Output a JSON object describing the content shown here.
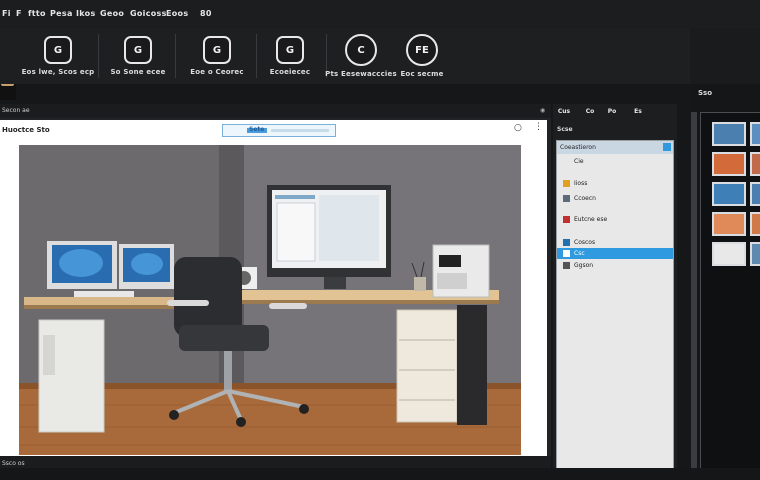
{
  "menubar": {
    "items": [
      "Fi",
      "F",
      "ftto",
      "Pesa",
      "Ikos",
      "Geoo",
      "Goicoss",
      "Eoos",
      "80"
    ]
  },
  "toolbar": {
    "tools": [
      {
        "icon_text": "G",
        "label": "Eos lwe, Scos ecp",
        "icon": "gear-icon"
      },
      {
        "icon_text": "G",
        "label": "So Sone ecee",
        "icon": "gear-icon"
      },
      {
        "icon_text": "G",
        "label": "Eoe o Ceorec",
        "icon": "gear-icon"
      },
      {
        "icon_text": "G",
        "label": "Ecoeiecec",
        "icon": "gear-icon"
      },
      {
        "icon_text": "C",
        "label": "Pts Eesewacccies",
        "icon": "globe-icon"
      },
      {
        "icon_text": "FE",
        "label": "Eoc secme",
        "icon": "fe-icon"
      }
    ]
  },
  "viewer": {
    "bar_label": "Secon ae",
    "doc_title": "Huoctce Sto",
    "tab_label": "Sete",
    "footer_label": "Ssco os"
  },
  "properties": {
    "header_buttons": [
      "Cus",
      "Co",
      "Po",
      "Es"
    ],
    "sub_label": "Scse",
    "list_title": "Coeastieron",
    "rows": [
      {
        "label": "Cie",
        "color": "#3a6ea5",
        "selected": false
      },
      {
        "label": "Iioss",
        "color": "#e0a020",
        "selected": false
      },
      {
        "label": "Ccoecn",
        "color": "#5b6b7b",
        "selected": false
      },
      {
        "label": "Eutcne ese",
        "color": "#c03030",
        "selected": false
      },
      {
        "label": "Coscos",
        "color": "#2070b0",
        "selected": false
      },
      {
        "label": "Csc",
        "color": "#2f9ae0",
        "selected": true
      },
      {
        "label": "Ggson",
        "color": "#555",
        "selected": false
      }
    ]
  },
  "thumbs": {
    "header": "Sso"
  },
  "colors": {
    "accent": "#2f9ae0",
    "panel_bg": "#1d1e20",
    "list_bg": "#e8e8e8"
  }
}
